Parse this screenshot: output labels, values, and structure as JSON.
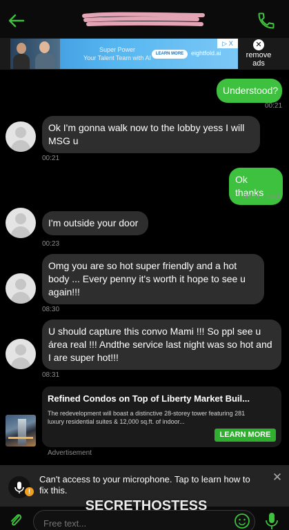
{
  "header": {
    "contact_name": "",
    "accent": "#3ec13e",
    "back_icon": "arrow-left-icon",
    "call_icon": "phone-icon"
  },
  "banner_ad": {
    "headline_line1": "Super Power",
    "headline_line2": "Your Talent Team with AI",
    "cta": "LEARN MORE",
    "brand": "eightfold.ai",
    "adchoices": "▷ X",
    "remove_ads": "remove ads"
  },
  "messages": [
    {
      "direction": "outgoing",
      "text": "Understood?",
      "time": "00:21"
    },
    {
      "direction": "incoming",
      "text": "Ok I'm gonna walk now to the lobby yess I will MSG u",
      "time": "00:21"
    },
    {
      "direction": "outgoing",
      "text": "Ok thanks",
      "time": "00:21 - Sent"
    },
    {
      "direction": "incoming",
      "text": "I'm outside your door",
      "time": "00:23"
    },
    {
      "direction": "incoming",
      "text": "Omg you are so hot super friendly and a hot body ... Every penny it's worth it hope to see u again!!!",
      "time": "08:30"
    },
    {
      "direction": "incoming",
      "text": "U should capture this convo Mami !!! So ppl see u área real !!! Andthe service last night was so hot and I are super hot!!!",
      "time": "08:31"
    }
  ],
  "native_ad": {
    "title": "Refined Condos on Top of Liberty Market Buil...",
    "body": "The redevelopment will boast a distinctive 28-storey tower featuring 281 luxury residential suites & 12,000 sq.ft. of indoor...",
    "cta": "LEARN MORE",
    "label": "Advertisement"
  },
  "mic_banner": {
    "text": "Can't access to your microphone. Tap to learn how to fix this.",
    "close": "✕"
  },
  "composer": {
    "placeholder": "Free text..."
  },
  "watermark": "SECRETHOSTESS"
}
